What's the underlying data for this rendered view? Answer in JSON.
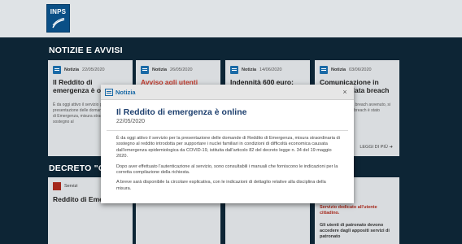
{
  "header": {
    "logo_text": "INPS"
  },
  "sections": {
    "news_title": "NOTIZIE E AVVISI",
    "decree_title": "DECRETO \"CURA"
  },
  "news_cards": [
    {
      "type": "Notizia",
      "date": "22/05/2020",
      "title": "Il Reddito di emergenza è online",
      "text": "È da oggi attivo il servizio per la presentazione delle domande di Reddito di Emergenza, misura straordinaria di sostegno al"
    },
    {
      "type": "Notizia",
      "date": "26/05/2020",
      "title": "Avviso agli utenti",
      "text": ""
    },
    {
      "type": "Notizia",
      "date": "14/06/2020",
      "title": "Indennità 600 euro: avviate le procedure di pagamento",
      "text": ""
    },
    {
      "type": "Notizia",
      "date": "03/06/2020",
      "title": "Comunicazione in merito al data breach",
      "text": "In relazione al data breach avvenuto, si informa che il data breach è stato comunicato al",
      "more": "LEGGI DI PIÙ"
    }
  ],
  "decree_cards": [
    {
      "type": "Servizi",
      "title": "Reddito di Emergen"
    }
  ],
  "side_card": {
    "title": "euro",
    "subtitle": "Servizio dedicato all'utente cittadino.",
    "text": "Gli utenti di patronato devono accedere dagli appositi servizi di patronato"
  },
  "modal": {
    "badge": "Notizia",
    "close": "×",
    "title": "Il Reddito di emergenza è online",
    "date": "22/05/2020",
    "paragraphs": [
      "È da oggi attivo il servizio per la presentazione delle domande di Reddito di Emergenza, misura straordinaria di sostegno al reddito introdotta per supportare i nuclei familiari in condizioni di difficoltà economica causata dall'emergenza epidemiologica da COVID-19, istituita dall'articolo 82 del decreto legge n. 34 del 19 maggio 2020.",
      "Dopo aver effettuato l'autenticazione al servizio, sono consultabili i manuali che forniscono le indicazioni per la corretta compilazione della richiesta.",
      "A breve sarà disponibile la circolare esplicativa, con le indicazioni di dettaglio relative alla disciplina della misura."
    ]
  },
  "colors": {
    "brand": "#0a4f86",
    "backdrop": "#0d2535",
    "accent_red": "#c0392b",
    "modal_title": "#1d3f6e"
  }
}
